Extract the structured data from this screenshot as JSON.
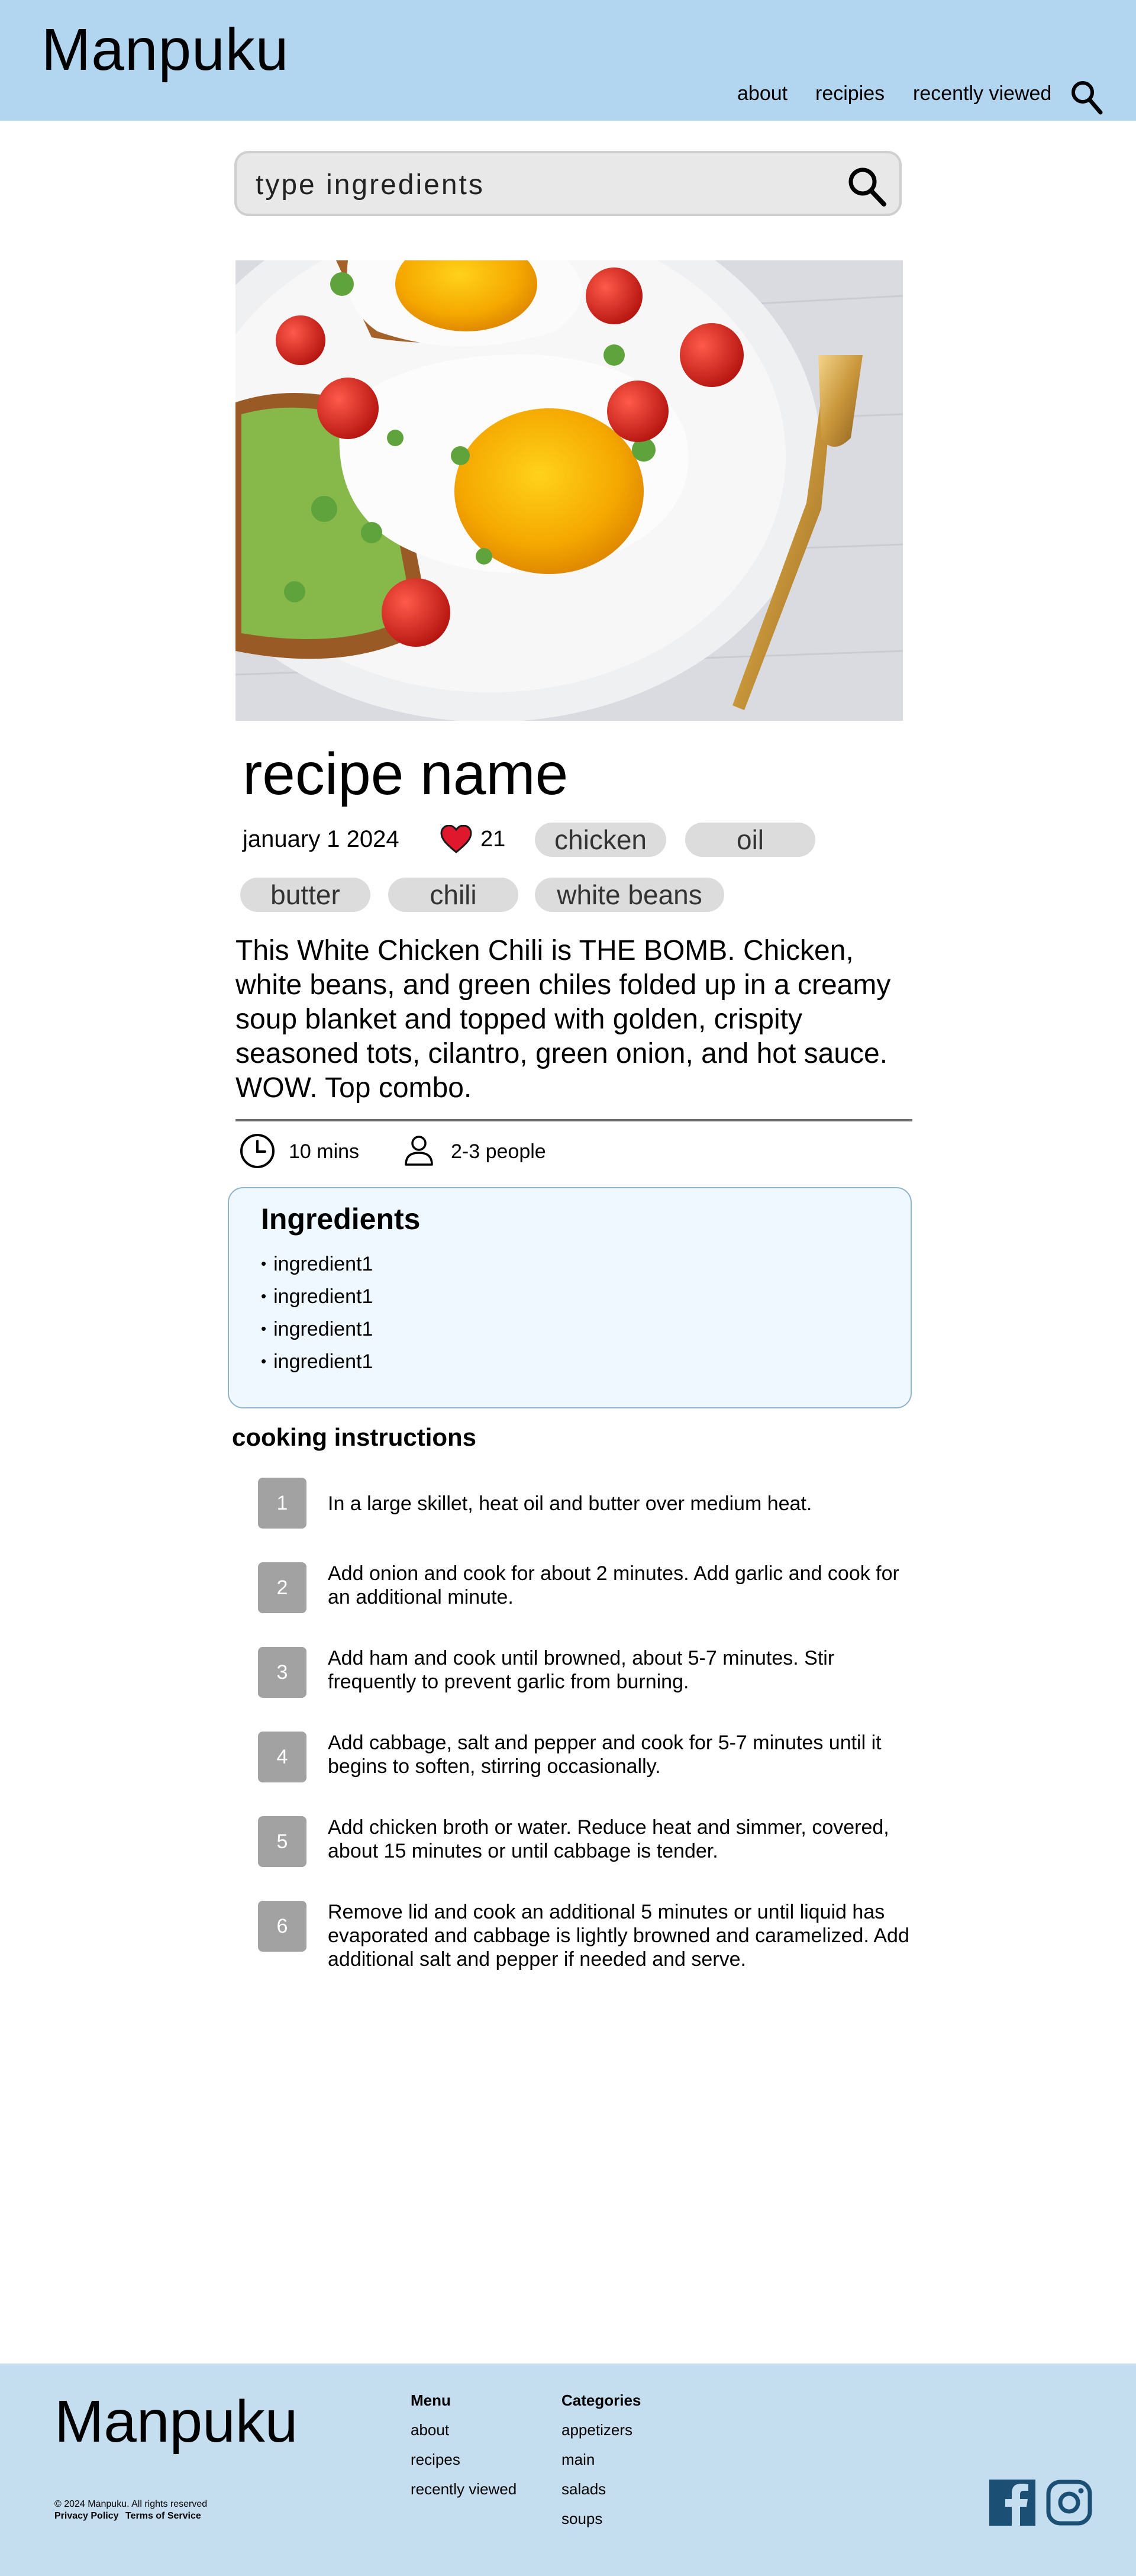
{
  "header": {
    "brand": "Manpuku",
    "nav": [
      "about",
      "recipies",
      "recently viewed"
    ],
    "search_icon": "search-icon"
  },
  "search": {
    "placeholder": "type ingredients",
    "value": "",
    "icon": "search-icon"
  },
  "recipe": {
    "image": "fried egg on avocado toast with cherry tomatoes and microgreens",
    "title": "recipe name",
    "date": "january 1 2024",
    "likes": "21",
    "tags": [
      "chicken",
      "oil",
      "butter",
      "chili",
      "white beans"
    ],
    "description": "This White Chicken Chili is THE BOMB. Chicken, white beans, and green chiles folded up in a creamy soup blanket and topped with golden, crispity seasoned tots, cilantro, green onion, and hot sauce. WOW. Top combo.",
    "time": "10 mins",
    "servings": "2-3 people",
    "icons": {
      "time": "clock-icon",
      "servings": "person-icon",
      "likes": "heart-icon"
    },
    "ingredients_title": "Ingredients",
    "ingredients": [
      "ingredient1",
      "ingredient1",
      "ingredient1",
      "ingredient1"
    ],
    "instructions_title": "cooking instructions",
    "steps": [
      {
        "n": "1",
        "text": "In a large skillet, heat oil and butter over medium heat."
      },
      {
        "n": "2",
        "text": "Add onion and cook for about 2 minutes. Add garlic and cook for an additional minute."
      },
      {
        "n": "3",
        "text": "Add ham and cook until browned, about 5-7 minutes. Stir frequently to prevent garlic from burning."
      },
      {
        "n": "4",
        "text": "Add cabbage, salt and pepper and cook for 5-7 minutes until it begins to soften, stirring occasionally."
      },
      {
        "n": "5",
        "text": "Add chicken broth or water. Reduce heat and simmer, covered, about 15 minutes or until cabbage is tender."
      },
      {
        "n": "6",
        "text": "Remove lid and cook an additional 5 minutes or until liquid has evaporated and cabbage is lightly browned and caramelized. Add additional salt and pepper if needed and serve."
      }
    ]
  },
  "footer": {
    "brand": "Manpuku",
    "menu_title": "Menu",
    "menu": [
      "about",
      "recipes",
      "recently viewed"
    ],
    "categories_title": "Categories",
    "categories": [
      "appetizers",
      "main",
      "salads",
      "soups"
    ],
    "copyright": "© 2024 Manpuku. All rights reserved",
    "privacy": "Privacy Policy",
    "terms": "Terms of Service",
    "social": [
      "facebook-icon",
      "instagram-icon"
    ]
  },
  "colors": {
    "header_bg": "#b3d6f0",
    "footer_bg": "#c4def0",
    "tag_bg": "#dcdcdc",
    "ingredients_bg": "#f0f8ff",
    "step_number_bg": "#a2a2a2",
    "heart": "#e0182d",
    "facebook": "#1b4f74"
  }
}
